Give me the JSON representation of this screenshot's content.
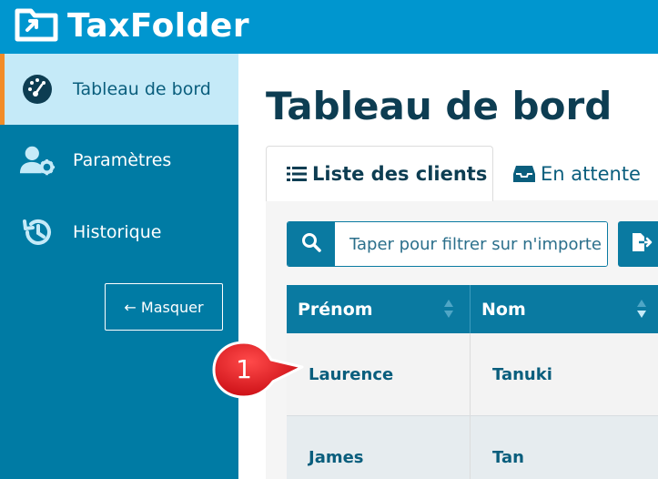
{
  "app": {
    "name": "TaxFolder"
  },
  "sidebar": {
    "items": [
      {
        "label": "Tableau de bord",
        "icon": "dashboard-gauge-icon",
        "active": true
      },
      {
        "label": "Paramètres",
        "icon": "user-gear-icon",
        "active": false
      },
      {
        "label": "Historique",
        "icon": "history-icon",
        "active": false
      }
    ],
    "hide_button": "← Masquer"
  },
  "main": {
    "title": "Tableau de bord",
    "tabs": [
      {
        "label": "Liste des clients",
        "icon": "list-icon",
        "active": true
      },
      {
        "label": "En attente",
        "icon": "inbox-icon",
        "active": false
      }
    ],
    "search": {
      "placeholder": "Taper pour filtrer sur n'importe quel champ",
      "value": ""
    },
    "table": {
      "columns": [
        "Prénom",
        "Nom"
      ],
      "rows": [
        [
          "Laurence",
          "Tanuki"
        ],
        [
          "James",
          "Tan"
        ]
      ]
    }
  },
  "callout": {
    "number": "1"
  },
  "colors": {
    "topbar": "#0096cf",
    "sidebar": "#007ba4",
    "sidebar_active": "#c5eaf8",
    "active_marker": "#f28c28",
    "title": "#0d3d52",
    "accent": "#0a7aa1",
    "callout": "#e8161e"
  }
}
